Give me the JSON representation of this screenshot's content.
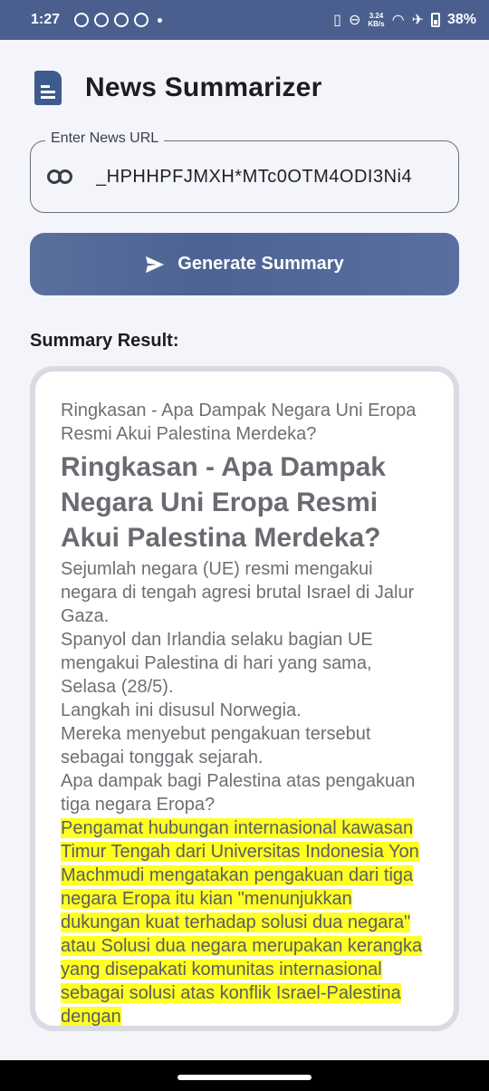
{
  "status": {
    "time": "1:27",
    "speed_value": "3.24",
    "speed_unit": "KB/s",
    "battery": "38%"
  },
  "app": {
    "title": "News Summarizer"
  },
  "url_field": {
    "label": "Enter News URL",
    "value": "_HPHHPFJMXH*MTc0OTM4ODI3Ni4"
  },
  "generate_button": {
    "label": "Generate Summary"
  },
  "summary": {
    "label": "Summary Result:",
    "subtitle": "Ringkasan - Apa Dampak Negara Uni Eropa Resmi Akui Palestina Merdeka?",
    "heading": "Ringkasan - Apa Dampak Negara Uni Eropa Resmi Akui Palestina Merdeka?",
    "paragraphs": [
      "Sejumlah negara (UE) resmi mengakui negara di tengah agresi brutal Israel di Jalur Gaza.",
      "Spanyol dan Irlandia selaku bagian UE mengakui Palestina di hari yang sama, Selasa (28/5).",
      "Langkah ini disusul Norwegia.",
      "Mereka menyebut pengakuan tersebut sebagai tonggak sejarah.",
      "Apa dampak bagi Palestina atas pengakuan tiga negara Eropa?"
    ],
    "highlighted": "Pengamat hubungan internasional kawasan Timur Tengah dari Universitas Indonesia Yon Machmudi mengatakan pengakuan dari tiga negara Eropa itu kian \"menunjukkan dukungan kuat terhadap solusi dua negara\" atau Solusi dua negara merupakan kerangka yang disepakati komunitas internasional sebagai solusi atas konflik Israel-Palestina dengan",
    "highlight_color": "#ffff22"
  },
  "colors": {
    "status_bar": "#4a5f8e",
    "accent": "#4d6393",
    "background": "#f4f4fb"
  }
}
